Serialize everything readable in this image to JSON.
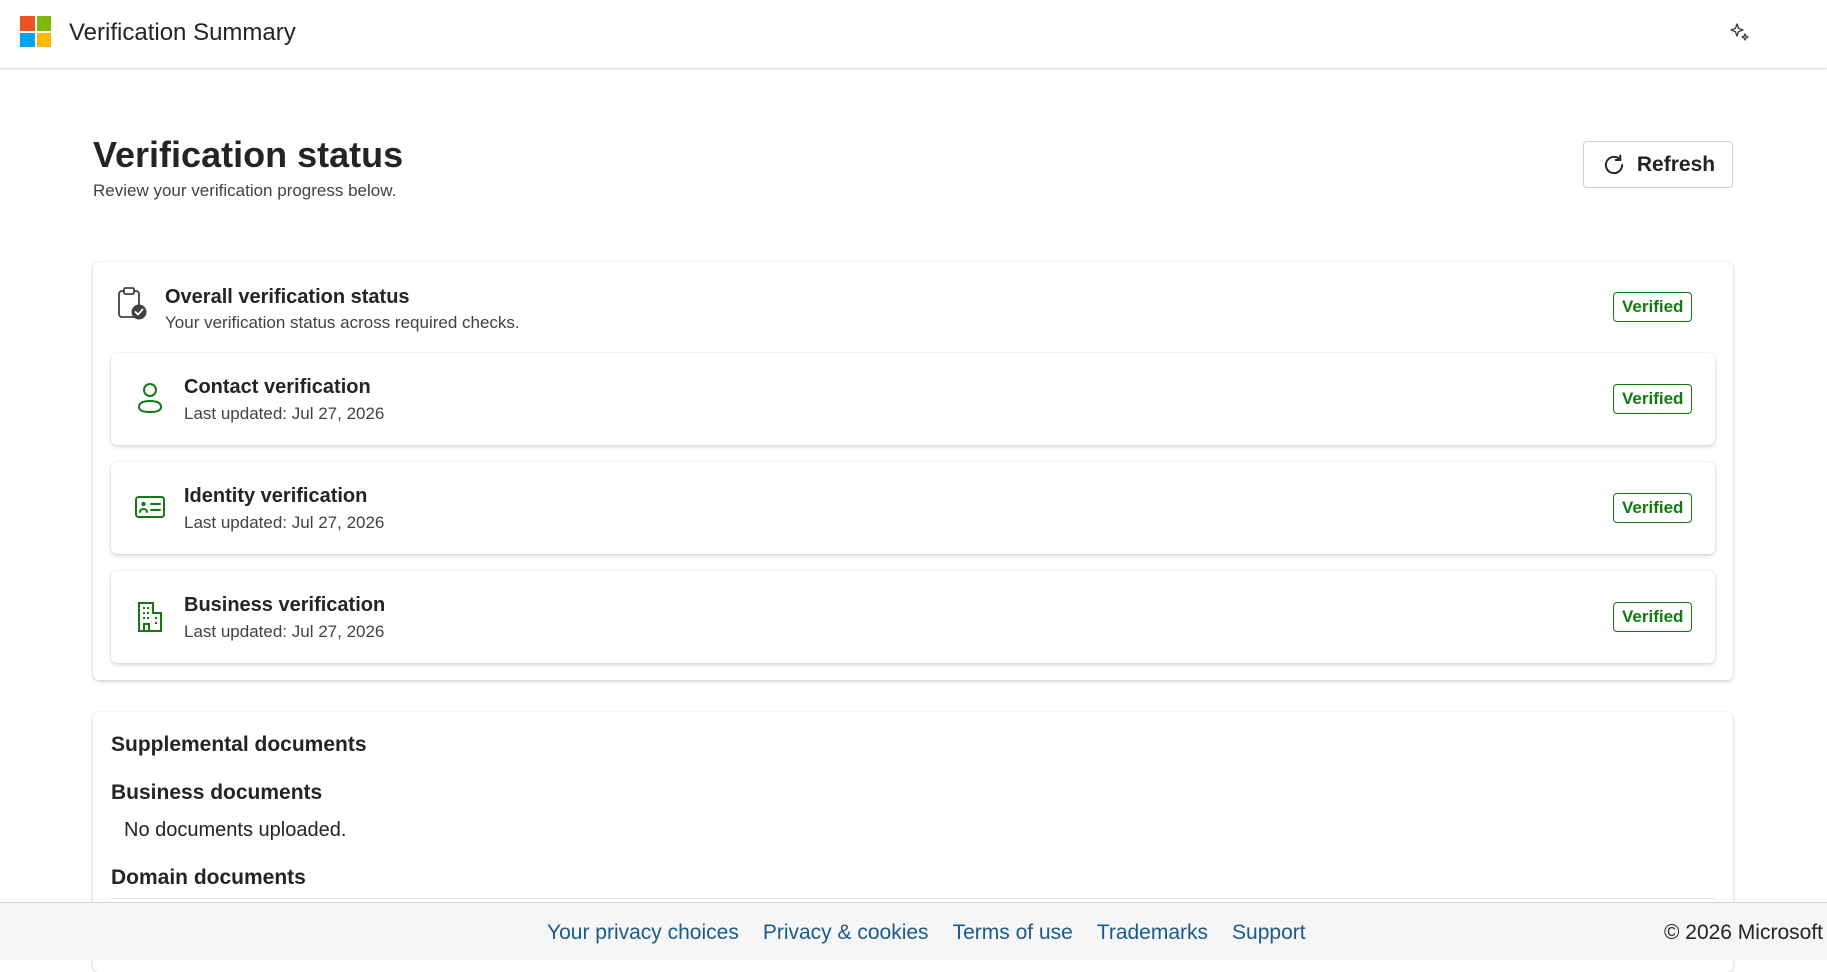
{
  "header": {
    "app_title": "Verification Summary",
    "logo_icon": "microsoft-logo",
    "assistant_icon": "sparkle-icon"
  },
  "main": {
    "title": "Verification status",
    "subtitle": "Review your verification progress below.",
    "refresh_label": "Refresh"
  },
  "overall": {
    "title": "Overall verification status",
    "subtitle": "Your verification status across required checks.",
    "status": "Verified",
    "icon": "clipboard-check-icon"
  },
  "checks": [
    {
      "title": "Contact verification",
      "updated": "Last updated: Jul 27, 2026",
      "status": "Verified",
      "icon": "person-icon"
    },
    {
      "title": "Identity verification",
      "updated": "Last updated: Jul 27, 2026",
      "status": "Verified",
      "icon": "id-card-icon"
    },
    {
      "title": "Business verification",
      "updated": "Last updated: Jul 27, 2026",
      "status": "Verified",
      "icon": "building-icon"
    }
  ],
  "documents": {
    "heading": "Supplemental documents",
    "business_heading": "Business documents",
    "business_empty": "No documents uploaded.",
    "domain_heading": "Domain documents"
  },
  "footer": {
    "links": [
      "Your privacy choices",
      "Privacy & cookies",
      "Terms of use",
      "Trademarks",
      "Support"
    ],
    "copyright": "© 2026 Microsoft"
  },
  "colors": {
    "accent_green": "#107c10",
    "link_blue": "#1a5a8f"
  }
}
